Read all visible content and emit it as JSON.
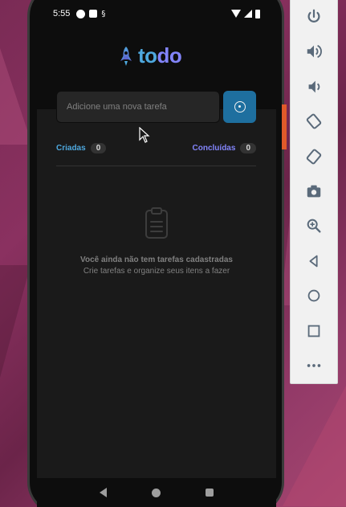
{
  "status_bar": {
    "time": "5:55"
  },
  "app": {
    "logo": {
      "part1": "to",
      "part2": "do"
    },
    "new_task": {
      "placeholder": "Adicione uma nova tarefa",
      "value": ""
    },
    "counters": {
      "created": {
        "label": "Criadas",
        "count": "0"
      },
      "done": {
        "label": "Concluídas",
        "count": "0"
      }
    },
    "empty_state": {
      "title": "Você ainda não tem tarefas cadastradas",
      "subtitle": "Crie tarefas e organize seus itens a fazer"
    }
  },
  "emulator_controls": [
    {
      "icon": "power-icon"
    },
    {
      "icon": "volume-up-icon"
    },
    {
      "icon": "volume-down-icon"
    },
    {
      "icon": "rotate-left-icon"
    },
    {
      "icon": "rotate-right-icon"
    },
    {
      "icon": "camera-icon"
    },
    {
      "icon": "zoom-icon"
    },
    {
      "icon": "back-icon"
    },
    {
      "icon": "home-icon"
    },
    {
      "icon": "overview-icon"
    },
    {
      "icon": "more-icon"
    }
  ],
  "colors": {
    "blue": "#4ea8de",
    "purple": "#8284fa",
    "button_blue": "#1e6f9f",
    "background": "#1a1a1a",
    "header": "#0d0d0d"
  }
}
